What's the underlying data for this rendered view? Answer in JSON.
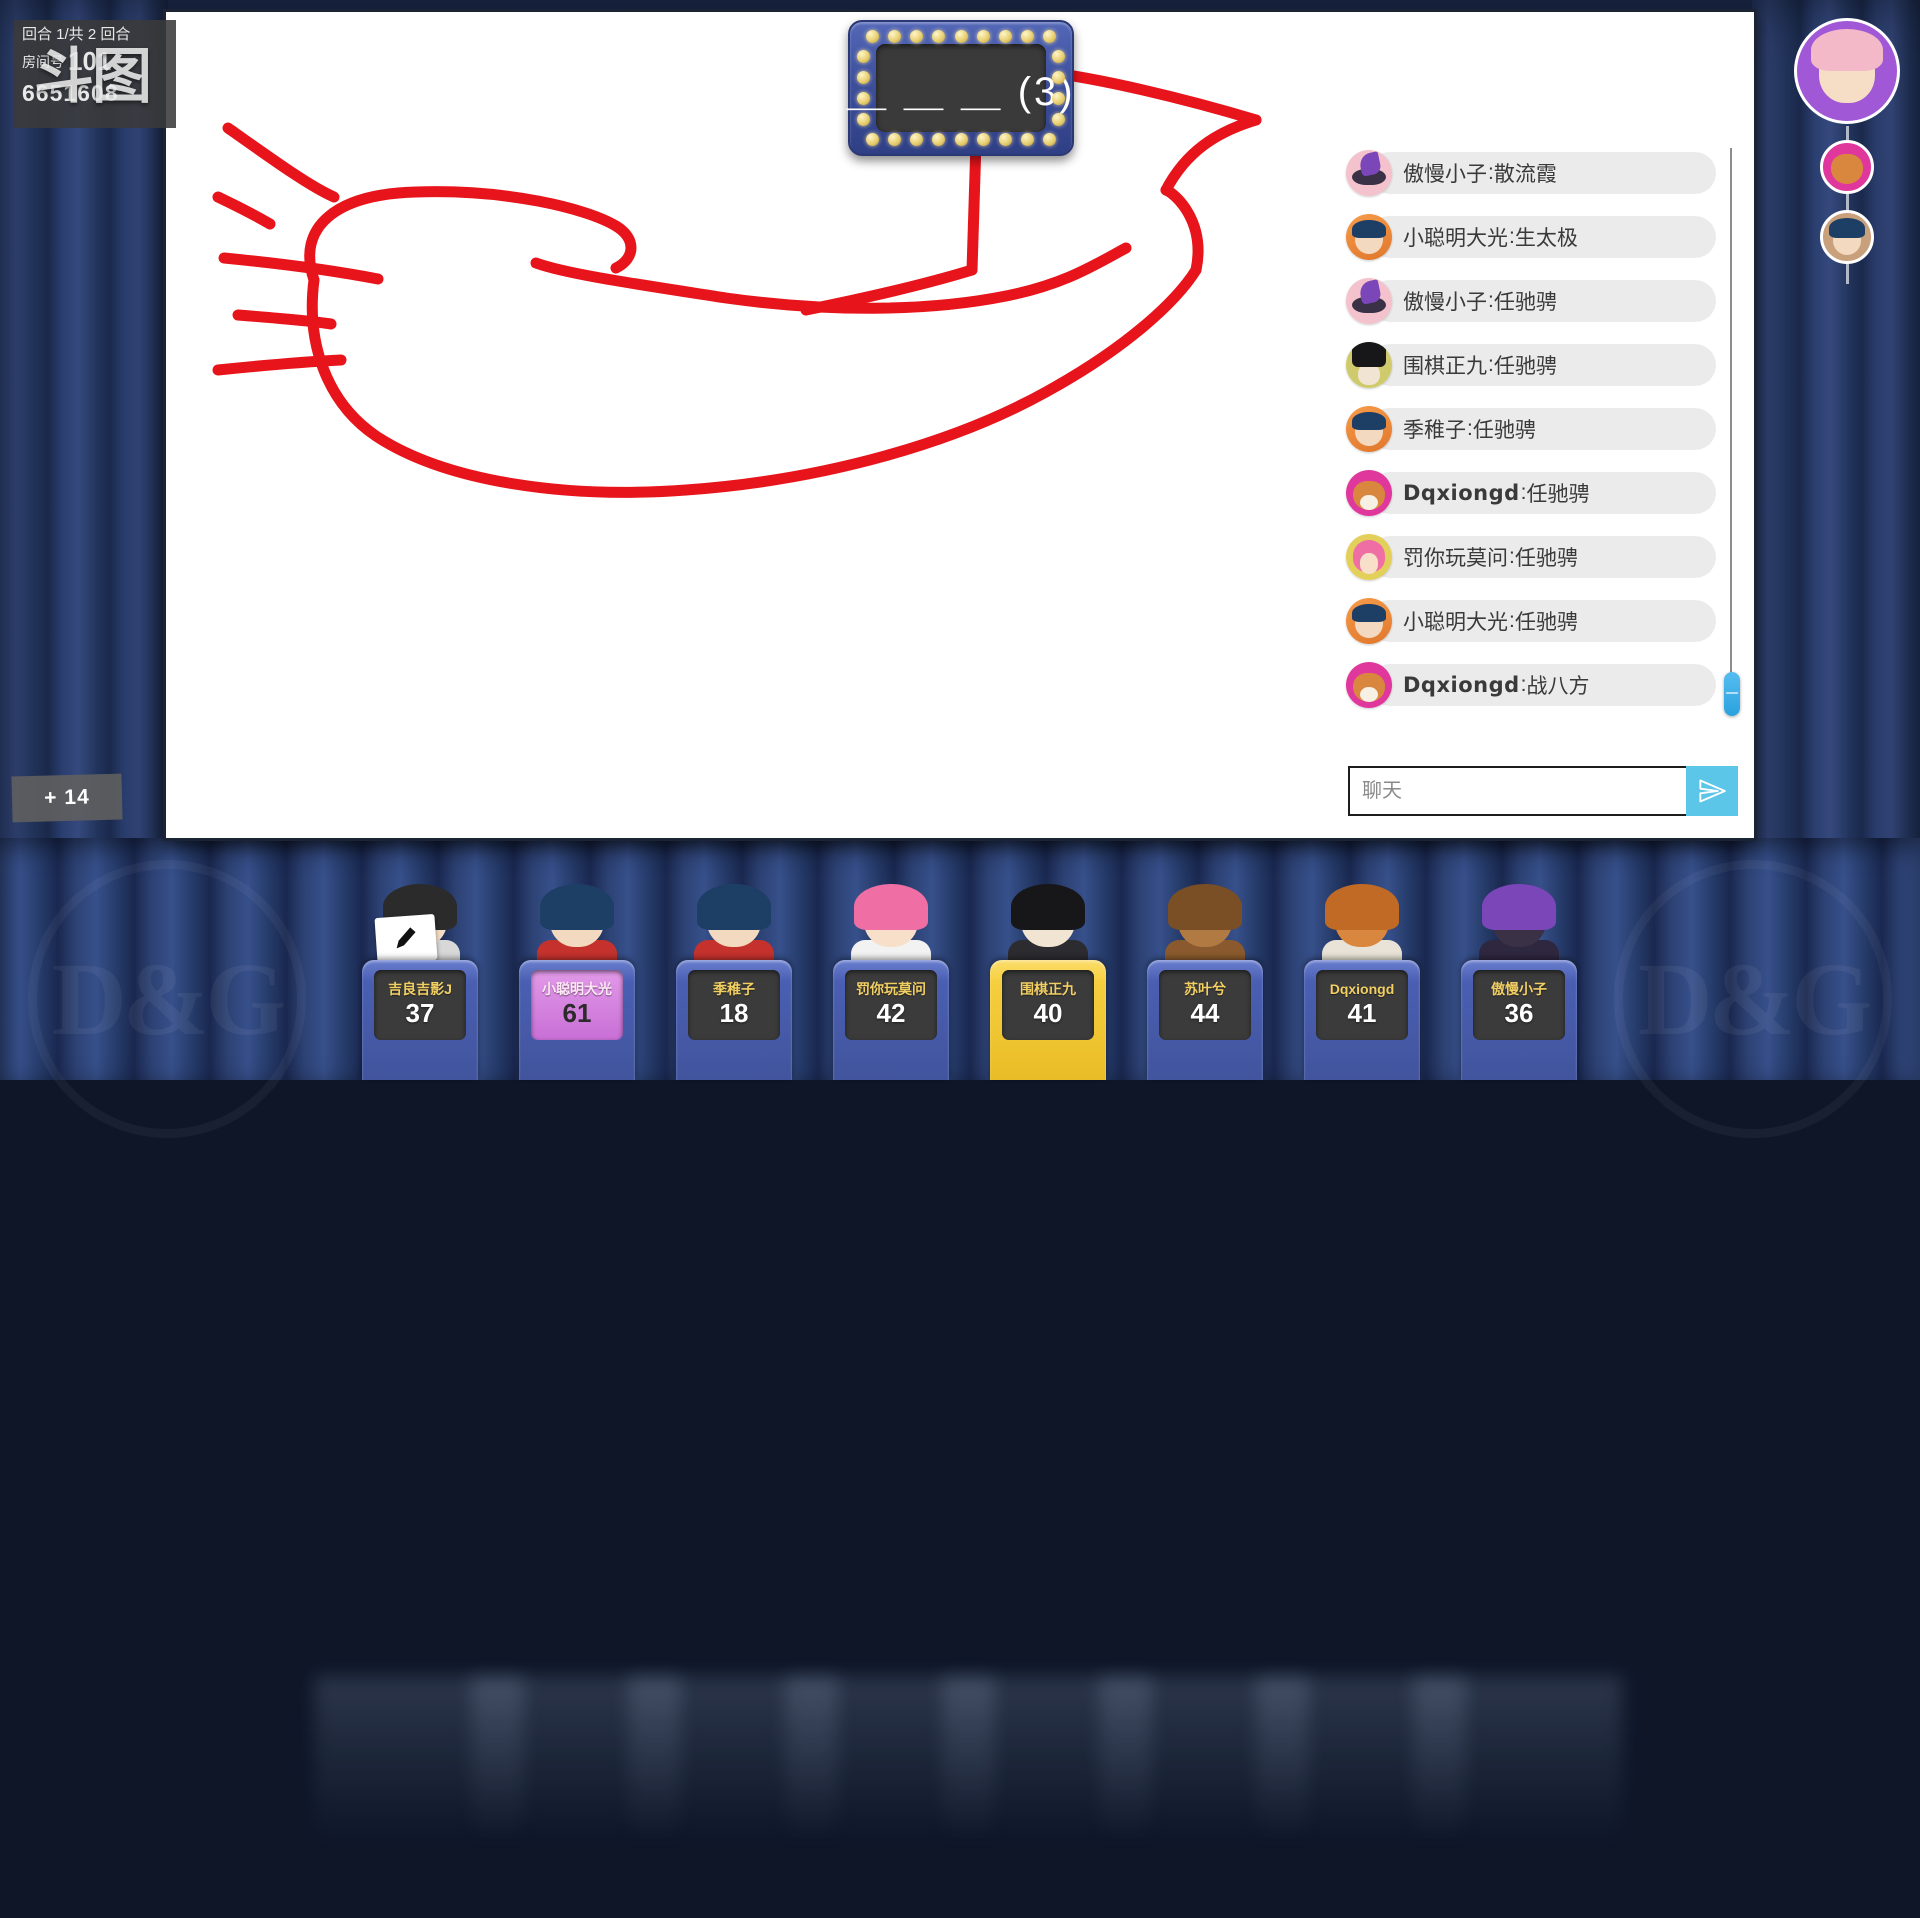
{
  "game": {
    "logo_text": "斗图",
    "round_label": "回合 1/共 2 回合",
    "room_label": "房间号",
    "room_number": "101",
    "room_id": "6651608",
    "curtain_logo": "D&G",
    "score_popup": "+ 14"
  },
  "word_board": {
    "hint": "＿ ＿ ＿ (3)",
    "letter_count": 3
  },
  "chat": {
    "input_placeholder": "聊天",
    "input_value": "",
    "send_icon": "send-icon",
    "messages": [
      {
        "nick": "傲慢小子",
        "text": "散流霞",
        "avatar": "av-hat",
        "latin": false
      },
      {
        "nick": "小聪明大光",
        "text": "生太极",
        "avatar": "av-girl",
        "latin": false
      },
      {
        "nick": "傲慢小子",
        "text": "任驰骋",
        "avatar": "av-hat",
        "latin": false
      },
      {
        "nick": "围棋正九",
        "text": "任驰骋",
        "avatar": "av-tophat",
        "latin": false
      },
      {
        "nick": "季稚子",
        "text": "任驰骋",
        "avatar": "av-girl",
        "latin": false
      },
      {
        "nick": "Dqxiongd",
        "text": "任驰骋",
        "avatar": "av-dog",
        "latin": true
      },
      {
        "nick": "罚你玩莫问",
        "text": "任驰骋",
        "avatar": "av-pink",
        "latin": false
      },
      {
        "nick": "小聪明大光",
        "text": "任驰骋",
        "avatar": "av-girl",
        "latin": false
      },
      {
        "nick": "Dqxiongd",
        "text": "战八方",
        "avatar": "av-dog",
        "latin": true
      }
    ]
  },
  "spectators": {
    "main_avatar": "artist-avatar",
    "small_avatars": [
      "dog-avatar",
      "girl-avatar"
    ]
  },
  "players": [
    {
      "name": "吉良吉影J",
      "score": "37",
      "state": "drawing",
      "plate": "dark",
      "skin": "#f5ddc6",
      "hair": "#2b2b2b",
      "body": "#d8d8d8"
    },
    {
      "name": "小聪明大光",
      "score": "61",
      "state": "guessed",
      "plate": "pink",
      "skin": "#f3d9c0",
      "hair": "#1d3f66",
      "body": "#c5322d"
    },
    {
      "name": "季稚子",
      "score": "18",
      "state": "normal",
      "plate": "dark",
      "skin": "#f3d9c0",
      "hair": "#1d3f66",
      "body": "#c5322d"
    },
    {
      "name": "罚你玩莫问",
      "score": "42",
      "state": "normal",
      "plate": "dark",
      "skin": "#f7dfc9",
      "hair": "#ef6fa4",
      "body": "#f2f2f2"
    },
    {
      "name": "围棋正九",
      "score": "40",
      "state": "active",
      "plate": "dark",
      "skin": "#f2e4d2",
      "hair": "#17171a",
      "body": "#2c2c30"
    },
    {
      "name": "苏叶兮",
      "score": "44",
      "state": "normal",
      "plate": "dark",
      "skin": "#b07a42",
      "hair": "#7a4f25",
      "body": "#8a5a2e"
    },
    {
      "name": "Dqxiongd",
      "score": "41",
      "state": "normal",
      "plate": "dark",
      "skin": "#d9873f",
      "hair": "#c06a25",
      "body": "#e8e3d6"
    },
    {
      "name": "傲慢小子",
      "score": "36",
      "state": "normal",
      "plate": "dark",
      "skin": "#3a3147",
      "hair": "#7a46b8",
      "body": "#2e2740"
    }
  ],
  "drawing": {
    "stroke_color": "#e8141b",
    "stroke_width": 11,
    "description": "red freehand outline of a fish-like shape with whisker lines"
  }
}
